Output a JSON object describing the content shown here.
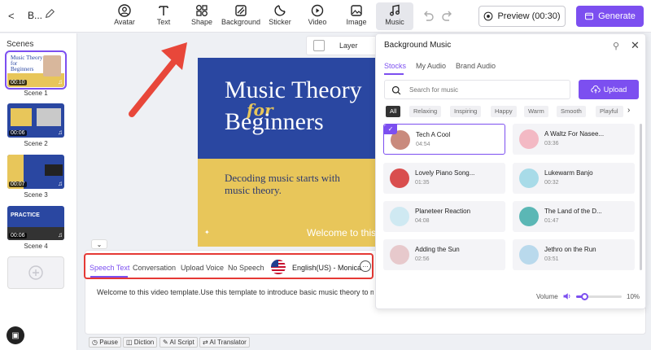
{
  "topbar": {
    "back_label": "<",
    "project_name": "B...",
    "tools": [
      {
        "label": "Avatar",
        "icon": "avatar-icon"
      },
      {
        "label": "Text",
        "icon": "text-icon"
      },
      {
        "label": "Shape",
        "icon": "shape-icon"
      },
      {
        "label": "Background",
        "icon": "background-icon"
      },
      {
        "label": "Sticker",
        "icon": "sticker-icon"
      },
      {
        "label": "Video",
        "icon": "video-icon"
      },
      {
        "label": "Image",
        "icon": "image-icon"
      },
      {
        "label": "Music",
        "icon": "music-icon",
        "active": true
      }
    ],
    "preview_label": "Preview (00:30)",
    "generate_label": "Generate"
  },
  "sidebar": {
    "title": "Scenes",
    "scenes": [
      {
        "name": "Scene 1",
        "duration": "00:10",
        "selected": true
      },
      {
        "name": "Scene 2",
        "duration": "00:06"
      },
      {
        "name": "Scene 3",
        "duration": "00:07"
      },
      {
        "name": "Scene 4",
        "duration": "00:06"
      }
    ],
    "add_symbol": "+"
  },
  "canvas": {
    "title_line1": "Music Theory",
    "title_for": "for",
    "title_line2": "Beginners",
    "subtitle": "Decoding music starts with music theory.",
    "welcome_overlay": "Welcome to this vide",
    "layer_label": "Layer",
    "colors": {
      "blue": "#2a47a1",
      "yellow": "#e8c65a"
    }
  },
  "speech": {
    "tabs": [
      "Speech Text",
      "Conversation",
      "Upload Voice",
      "No Speech"
    ],
    "active_tab": "Speech Text",
    "voice": "English(US) - Monica",
    "text": "Welcome to this video template.Use this template to introduce basic music theory to music lo",
    "chips": [
      "Pause",
      "Diction",
      "AI Script",
      "AI Translator"
    ]
  },
  "music_panel": {
    "title": "Background Music",
    "tabs": [
      "Stocks",
      "My Audio",
      "Brand Audio"
    ],
    "search_placeholder": "Search for music",
    "upload_label": "Upload",
    "filters": [
      "All",
      "Relaxing",
      "Inspiring",
      "Happy",
      "Warm",
      "Smooth",
      "Playful"
    ],
    "tracks": [
      {
        "name": "Tech A Cool",
        "duration": "04:54",
        "selected": true,
        "color": "#c98a7d"
      },
      {
        "name": "A Waltz For Nasee...",
        "duration": "03:36",
        "color": "#f3b9c4"
      },
      {
        "name": "Lovely Piano Song...",
        "duration": "01:35",
        "color": "#d94e4e"
      },
      {
        "name": "Lukewarm Banjo",
        "duration": "00:32",
        "color": "#a8dbe8"
      },
      {
        "name": "Planeteer Reaction",
        "duration": "04:08",
        "color": "#cfe9f2"
      },
      {
        "name": "The Land of the D...",
        "duration": "01:47",
        "color": "#5bb7b5"
      },
      {
        "name": "Adding the Sun",
        "duration": "02:56",
        "color": "#e7c9cc"
      },
      {
        "name": "Jethro on the Run",
        "duration": "03:51",
        "color": "#b9d9ec"
      }
    ],
    "volume_label": "Volume",
    "volume_value": "10%",
    "volume_fraction": 0.1,
    "accent": "#7c4ff0"
  }
}
